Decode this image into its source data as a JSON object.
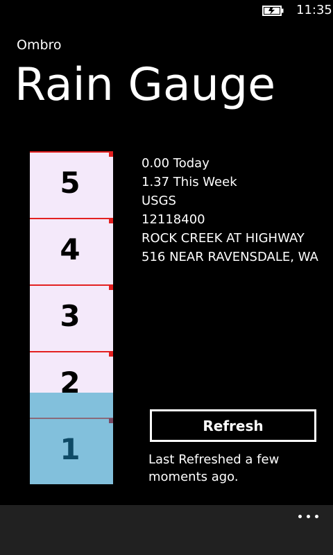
{
  "status_bar": {
    "time": "11:35",
    "battery_icon": "battery-charging-icon"
  },
  "app": {
    "name": "Ombro",
    "title": "Rain Gauge"
  },
  "gauge": {
    "labels": [
      "5",
      "4",
      "3",
      "2",
      "1"
    ],
    "level": 1.37,
    "max": 5,
    "fill_color": "#82c0dc",
    "background_color": "#f4e9fa",
    "line_color": "#e32020"
  },
  "info": {
    "today": "0.00 Today",
    "week": "1.37 This Week",
    "source": "USGS",
    "station_id": "12118400",
    "station_name_line1": "ROCK CREEK AT HIGHWAY",
    "station_name_line2": "516 NEAR RAVENSDALE, WA"
  },
  "refresh": {
    "button_label": "Refresh",
    "status_text": "Last Refreshed a few moments ago."
  },
  "app_bar": {
    "more_icon": "ellipsis-icon"
  }
}
